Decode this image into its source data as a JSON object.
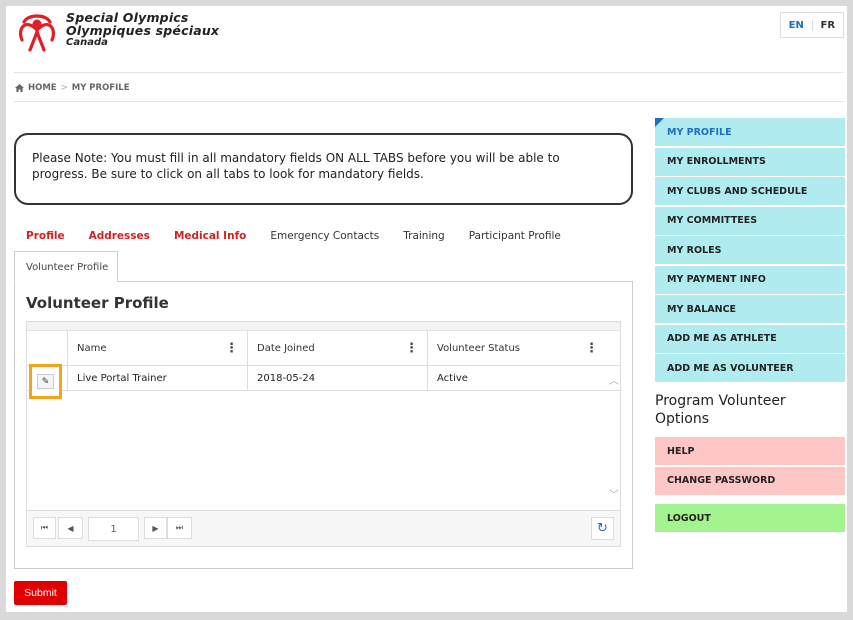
{
  "brand": {
    "line1": "Special Olympics",
    "line2": "Olympiques spéciaux",
    "line3": "Canada",
    "logo_icon": "special-olympics-logo",
    "logo_color": "#e01f26"
  },
  "lang": {
    "en": "EN",
    "fr": "FR"
  },
  "breadcrumb": {
    "home": "HOME",
    "sep": ">",
    "current": "MY PROFILE"
  },
  "note": "Please Note: You must fill in all mandatory fields ON ALL TABS before you will be able to progress. Be sure to click on all tabs to look for mandatory fields.",
  "tabs": [
    {
      "label": "Profile",
      "required": true
    },
    {
      "label": "Addresses",
      "required": true
    },
    {
      "label": "Medical Info",
      "required": true
    },
    {
      "label": "Emergency Contacts",
      "required": false
    },
    {
      "label": "Training",
      "required": false
    },
    {
      "label": "Participant Profile",
      "required": false
    }
  ],
  "active_tab": "Volunteer Profile",
  "panel_title": "Volunteer Profile",
  "grid": {
    "columns": [
      "Name",
      "Date Joined",
      "Volunteer Status"
    ],
    "rows": [
      {
        "name": "Live Portal Trainer",
        "date": "2018-05-24",
        "status": "Active"
      }
    ],
    "page": "1"
  },
  "submit_label": "Submit",
  "sidebar": {
    "items": [
      "MY PROFILE",
      "MY ENROLLMENTS",
      "MY CLUBS AND SCHEDULE",
      "MY COMMITTEES",
      "MY ROLES",
      "MY PAYMENT INFO",
      "MY BALANCE",
      "ADD ME AS ATHLETE",
      "ADD ME AS VOLUNTEER"
    ],
    "section_title": "Program Volunteer Options",
    "pink_items": [
      "HELP",
      "CHANGE PASSWORD"
    ],
    "logout": "LOGOUT"
  },
  "colors": {
    "accent_blue": "#1a6fc4",
    "required_red": "#d32020",
    "sidebar_cyan": "#b0ecef",
    "sidebar_pink": "#ffc6c6",
    "logout_green": "#a3f48e",
    "submit_red": "#e00000",
    "highlight_orange": "#f2a51a"
  }
}
